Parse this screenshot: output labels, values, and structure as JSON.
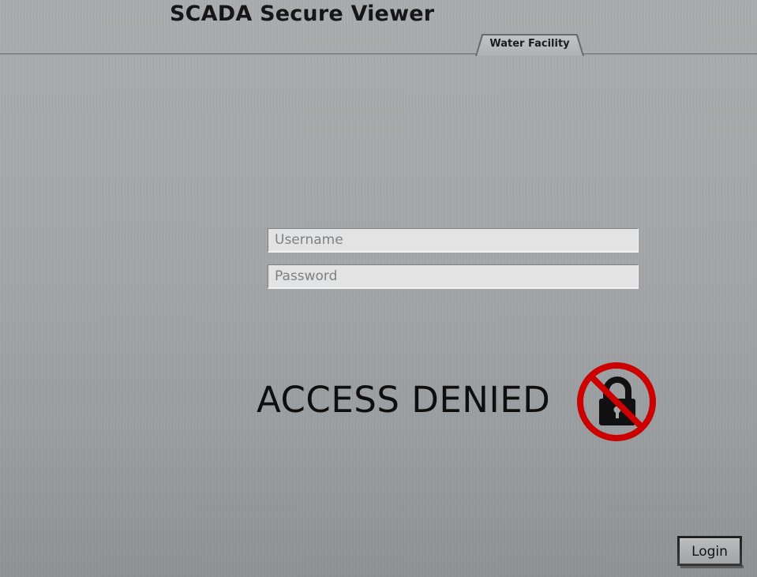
{
  "header": {
    "title": "SCADA Secure Viewer",
    "tab_label": "Water Facility"
  },
  "login_form": {
    "username_placeholder": "Username",
    "password_placeholder": "Password",
    "login_label": "Login"
  },
  "status": {
    "message": "ACCESS DENIED",
    "icon": "locked-prohibited-icon"
  },
  "colors": {
    "background": "#a3a6a8",
    "prohibition_red": "#cc0000",
    "text": "#111111"
  }
}
